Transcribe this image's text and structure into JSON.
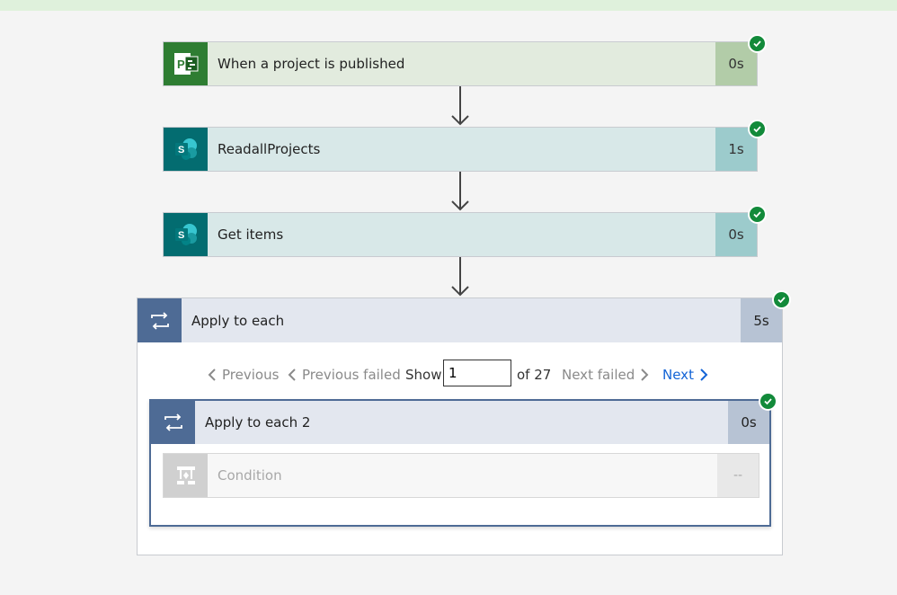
{
  "steps": [
    {
      "title": "When a project is published",
      "duration": "0s",
      "icon": "project-online-icon",
      "color": "#2e7d32"
    },
    {
      "title": "ReadallProjects",
      "duration": "1s",
      "icon": "sharepoint-icon",
      "color": "#036c70"
    },
    {
      "title": "Get items",
      "duration": "0s",
      "icon": "sharepoint-icon",
      "color": "#036c70"
    }
  ],
  "apply_each": {
    "title": "Apply to each",
    "duration": "5s",
    "icon": "loop-icon",
    "pager": {
      "previous": "Previous",
      "previous_failed": "Previous failed",
      "show": "Show",
      "current": "1",
      "of_total": "of 27",
      "next_failed": "Next failed",
      "next": "Next"
    },
    "inner": {
      "title": "Apply to each 2",
      "duration": "0s",
      "icon": "loop-icon",
      "condition": {
        "title": "Condition",
        "duration": "--",
        "icon": "condition-icon"
      }
    }
  },
  "colors": {
    "success": "#128a3a",
    "loop": "#4e6b95",
    "link": "#1464d6"
  }
}
